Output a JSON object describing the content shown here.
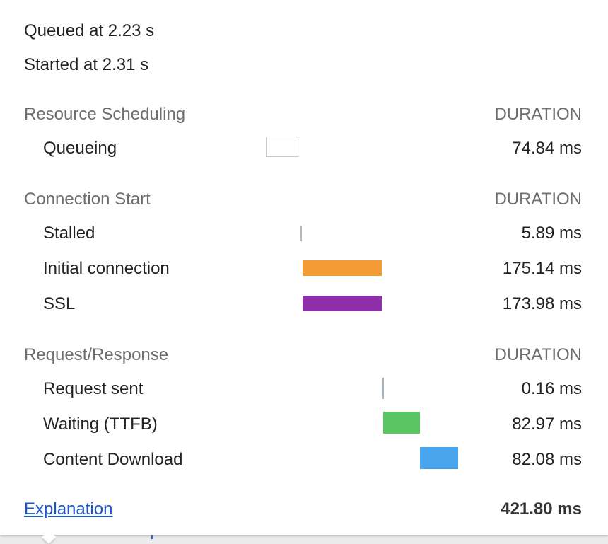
{
  "header": {
    "queued": "Queued at 2.23 s",
    "started": "Started at 2.31 s"
  },
  "sections": {
    "resource_scheduling": {
      "title": "Resource Scheduling",
      "duration_header": "DURATION",
      "rows": [
        {
          "label": "Queueing",
          "value": "74.84 ms",
          "color": "#ffffff"
        }
      ]
    },
    "connection_start": {
      "title": "Connection Start",
      "duration_header": "DURATION",
      "rows": [
        {
          "label": "Stalled",
          "value": "5.89 ms",
          "color": "#b8b8b8"
        },
        {
          "label": "Initial connection",
          "value": "175.14 ms",
          "color": "#f39c36"
        },
        {
          "label": "SSL",
          "value": "173.98 ms",
          "color": "#8d2fa8"
        }
      ]
    },
    "request_response": {
      "title": "Request/Response",
      "duration_header": "DURATION",
      "rows": [
        {
          "label": "Request sent",
          "value": "0.16 ms",
          "color": "#a8b4c0"
        },
        {
          "label": "Waiting (TTFB)",
          "value": "82.97 ms",
          "color": "#5ac563"
        },
        {
          "label": "Content Download",
          "value": "82.08 ms",
          "color": "#4aa5ec"
        }
      ]
    }
  },
  "footer": {
    "explanation_link": "Explanation",
    "total": "421.80 ms"
  }
}
